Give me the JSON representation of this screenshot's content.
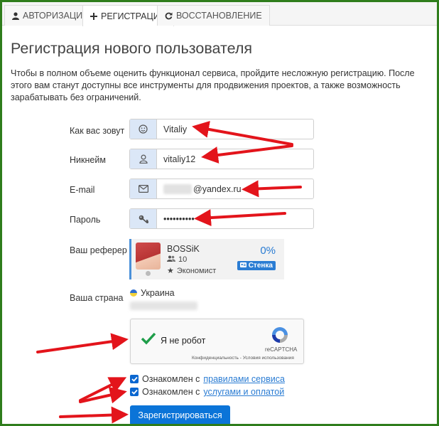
{
  "tabs": [
    {
      "label": "Авторизация",
      "icon": "user-icon",
      "active": false
    },
    {
      "label": "Регистрация",
      "icon": "plus-icon",
      "active": true
    },
    {
      "label": "Восстановление",
      "icon": "refresh-icon",
      "active": false
    }
  ],
  "page": {
    "title": "Регистрация нового пользователя",
    "intro": "Чтобы в полном объеме оценить функционал сервиса, пройдите несложную регистрацию. После этого вам станут доступны все инструменты для продвижения проектов, а также возможность зарабатывать без ограничений."
  },
  "form": {
    "name": {
      "label": "Как вас зовут",
      "value": "Vitaliy",
      "icon": "smile-icon"
    },
    "nickname": {
      "label": "Никнейм",
      "value": "vitaliy12",
      "icon": "user-outline-icon"
    },
    "email": {
      "label": "E-mail",
      "value_visible": "@yandex.ru",
      "icon": "envelope-icon"
    },
    "password": {
      "label": "Пароль",
      "value": "••••••••••",
      "icon": "key-icon"
    },
    "referrer": {
      "label": "Ваш реферер",
      "name": "BOSSiK",
      "level": "10",
      "status": "Экономист",
      "percent": "0%",
      "badge": "Стенка"
    },
    "country": {
      "label": "Ваша страна",
      "value": "Украина"
    },
    "captcha": {
      "text": "Я не робот",
      "brand": "reCAPTCHA",
      "links": "Конфиденциальность - Условия использования"
    },
    "agree_rules": {
      "prefix": "Ознакомлен с",
      "link": "правилами сервиса",
      "checked": true
    },
    "agree_services": {
      "prefix": "Ознакомлен с",
      "link": "услугами и оплатой",
      "checked": true
    },
    "submit": "Зарегистрироваться"
  },
  "colors": {
    "frame": "#2f7d1c",
    "accent": "#0b74d8",
    "arrow": "#e3141b",
    "addon": "#dbe7f7"
  }
}
